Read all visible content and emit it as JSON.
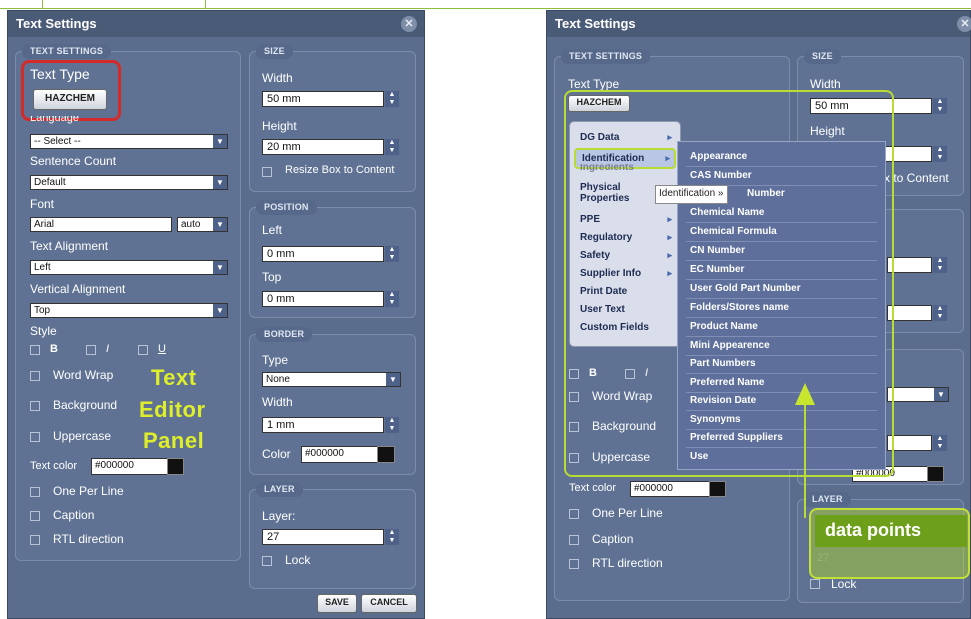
{
  "left": {
    "title": "Text Settings",
    "close": "✕",
    "sections": {
      "text_settings": "TEXT SETTINGS",
      "size": "SIZE",
      "position": "POSITION",
      "border": "BORDER",
      "layer": "LAYER"
    },
    "text_type_label": "Text Type",
    "hazchem_label": "HAZCHEM",
    "language_label": "Language",
    "language_value": "-- Select --",
    "sentence_count_label": "Sentence Count",
    "sentence_count_value": "Default",
    "font_label": "Font",
    "font_value": "Arial",
    "font_size_value": "auto",
    "text_alignment_label": "Text Alignment",
    "text_alignment_value": "Left",
    "vertical_alignment_label": "Vertical Alignment",
    "vertical_alignment_value": "Top",
    "style_label": "Style",
    "bold_label": "B",
    "italic_label": "I",
    "underline_label": "U",
    "word_wrap_label": "Word Wrap",
    "background_label": "Background",
    "uppercase_label": "Uppercase",
    "text_color_label": "Text color",
    "text_color_value": "#000000",
    "one_per_line_label": "One Per Line",
    "caption_label": "Caption",
    "rtl_label": "RTL direction",
    "width_label": "Width",
    "width_value": "50 mm",
    "height_label": "Height",
    "height_value": "20 mm",
    "resize_label": "Resize Box to Content",
    "left_label": "Left",
    "left_value": "0 mm",
    "top_label": "Top",
    "top_value": "0 mm",
    "border_type_label": "Type",
    "border_type_value": "None",
    "border_width_label": "Width",
    "border_width_value": "1 mm",
    "border_color_label": "Color",
    "border_color_value": "#000000",
    "layer_label": "Layer:",
    "layer_value": "27",
    "lock_label": "Lock",
    "save_label": "SAVE",
    "cancel_label": "CANCEL",
    "annotation_line1": "Text",
    "annotation_line2": "Editor",
    "annotation_line3": "Panel"
  },
  "right": {
    "title": "Text Settings",
    "close": "✕",
    "sections": {
      "text_settings": "TEXT SETTINGS",
      "size": "SIZE",
      "layer": "LAYER"
    },
    "text_type_label": "Text Type",
    "hazchem_label": "HAZCHEM",
    "width_label": "Width",
    "width_value": "50 mm",
    "height_label": "Height",
    "resize_partial": "x to Content",
    "bold_label": "B",
    "italic_label": "I",
    "word_wrap_label": "Word Wrap",
    "background_label": "Background",
    "uppercase_label": "Uppercase",
    "text_color_label": "Text color",
    "text_color_value": "#000000",
    "partial_color_value": "#000000",
    "one_per_line_label": "One Per Line",
    "caption_label": "Caption",
    "rtl_label": "RTL direction",
    "layer_value": "27",
    "lock_label": "Lock",
    "menu_items": [
      "DG Data",
      "Identification",
      "Ingredients",
      "Physical Properties",
      "PPE",
      "Regulatory",
      "Safety",
      "Supplier Info",
      "Print Date",
      "User Text",
      "Custom Fields"
    ],
    "tooltip": "Identification »",
    "tooltip_tail": "Number",
    "submenu_items": [
      "Appearance",
      "CAS Number",
      "Chemical Name",
      "Chemical Formula",
      "CN Number",
      "EC Number",
      "User Gold Part Number",
      "Folders/Stores name",
      "Product Name",
      "Mini Appearence",
      "Part Numbers",
      "Preferred Name",
      "Revision Date",
      "Synonyms",
      "Preferred Suppliers",
      "Use"
    ],
    "data_points_label": "data points"
  }
}
